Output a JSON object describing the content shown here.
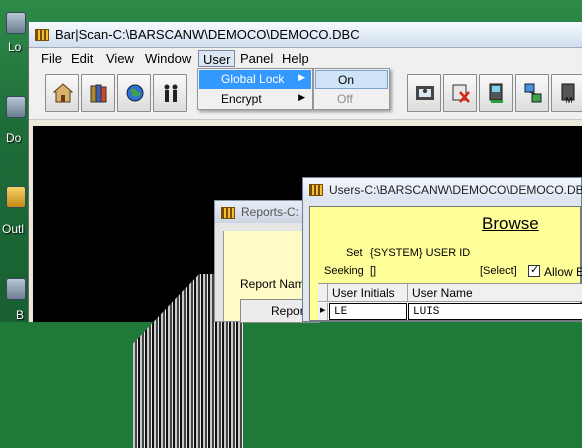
{
  "desktop": {
    "labels": [
      "Lo",
      "Do",
      "Outl",
      "B"
    ],
    "colors": {
      "background": "#1e6d39"
    }
  },
  "main_window": {
    "title": "Bar|Scan-C:\\BARSCANW\\DEMOCO\\DEMOCO.DBC",
    "menus": [
      "File",
      "Edit",
      "View",
      "Window",
      "User",
      "Panel",
      "Help"
    ],
    "active_menu": "User",
    "toolbar_icons": [
      "house-icon",
      "books-icon",
      "globe-icon",
      "people-icon",
      "filmstrip-person-icon",
      "delete-record-icon",
      "computer-icon",
      "network-icon",
      "report-icon"
    ]
  },
  "user_menu": {
    "items": [
      {
        "label": "Global Lock",
        "has_submenu": true,
        "selected": true
      },
      {
        "label": "Encrypt",
        "has_submenu": true,
        "selected": false
      }
    ]
  },
  "lock_submenu": {
    "items": [
      {
        "label": "On",
        "enabled": true,
        "selected": true
      },
      {
        "label": "Off",
        "enabled": false,
        "selected": false
      }
    ]
  },
  "reports_window": {
    "title": "Reports-C:",
    "report_name_label": "Report Nam",
    "report_button_label": "Report"
  },
  "users_window": {
    "title": "Users-C:\\BARSCANW\\DEMOCO\\DEMOCO.DBC",
    "heading": "Browse",
    "set_label": "Set",
    "set_value": "{SYSTEM} USER ID",
    "seeking_label": "Seeking",
    "seeking_value": "[]",
    "select_label": "[Select]",
    "allow_label": "Allow E",
    "columns": [
      "User Initials",
      "User Name"
    ],
    "rows": [
      {
        "initials": "LE",
        "name": "LUIS"
      }
    ]
  }
}
